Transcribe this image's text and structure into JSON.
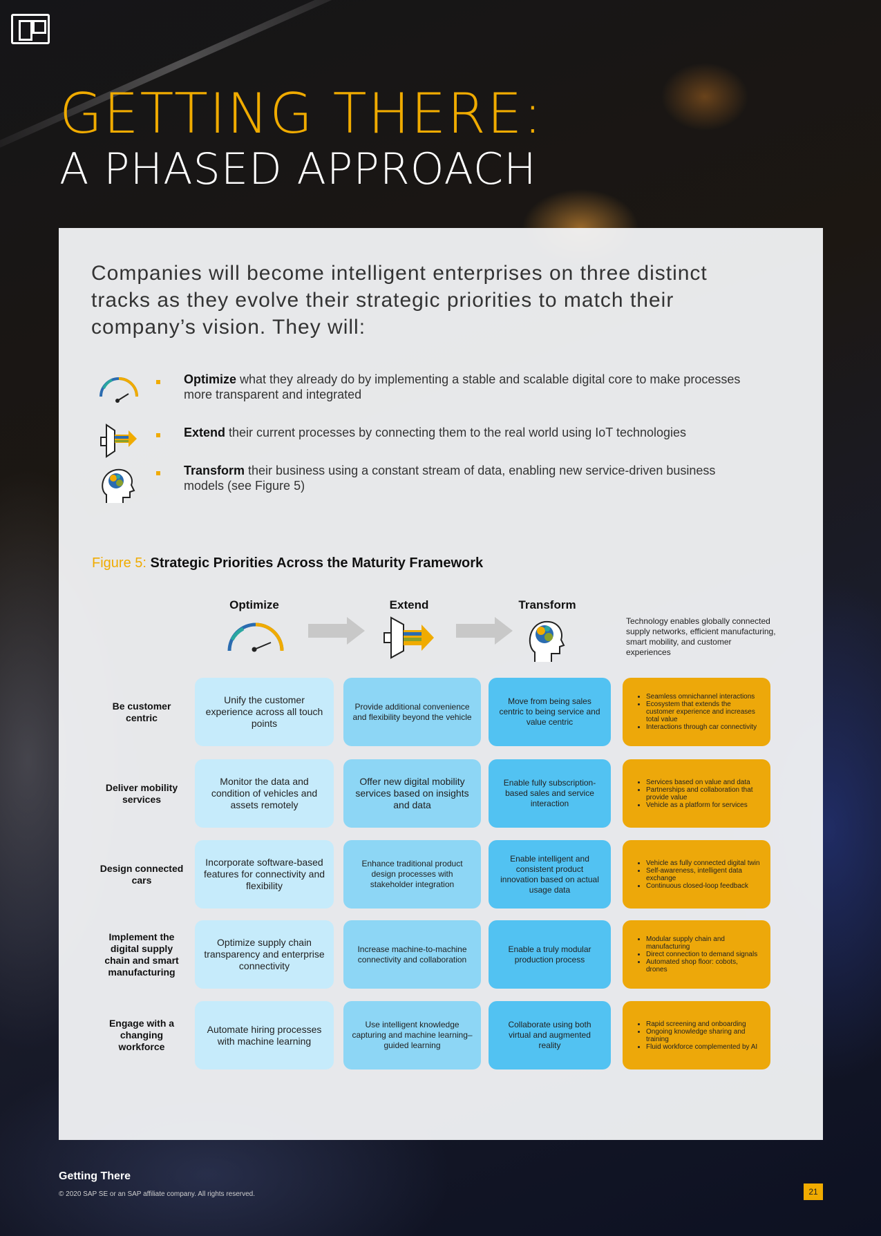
{
  "header": {
    "title_line1": "GETTING THERE:",
    "title_line2": "A PHASED APPROACH"
  },
  "intro": "Companies will become intelligent enterprises on three distinct tracks as they evolve their strategic priorities to match their company’s vision. They will:",
  "bullets": [
    {
      "icon": "gauge-icon",
      "bold": "Optimize",
      "text": " what they already do by implementing a stable and scalable digital core to make processes more transparent and integrated"
    },
    {
      "icon": "extend-arrow-icon",
      "bold": "Extend",
      "text": " their current processes by connecting them to the real world using IoT technologies"
    },
    {
      "icon": "brain-head-icon",
      "bold": "Transform",
      "text": " their business using a constant stream of data, enabling new service-driven business models (see Figure 5)"
    }
  ],
  "figure": {
    "label": "Figure 5:",
    "title": " Strategic Priorities Across the Maturity Framework",
    "columns": [
      "Optimize",
      "Extend",
      "Transform"
    ],
    "tech_note": "Technology enables globally connected supply networks, efficient manufacturing, smart mobility, and customer experiences",
    "rows": [
      {
        "label": "Be customer centric",
        "optimize": "Unify the customer experience across all touch points",
        "extend": "Provide additional convenience and flexibility beyond the vehicle",
        "transform": "Move from being sales centric to being service and value centric",
        "tech": [
          "Seamless omnichannel interactions",
          "Ecosystem that extends the customer experience and increases total value",
          "Interactions through car connectivity"
        ]
      },
      {
        "label": "Deliver mobility services",
        "optimize": "Monitor the data and condition of vehicles and assets remotely",
        "extend": "Offer new digital mobility services based on insights and data",
        "transform": "Enable fully subscription-based sales and service interaction",
        "tech": [
          "Services based on value and data",
          "Partnerships and collaboration that provide value",
          "Vehicle as a platform for services"
        ]
      },
      {
        "label": "Design connected cars",
        "optimize": "Incorporate software-based features for connectivity and flexibility",
        "extend": "Enhance traditional product design processes with stakeholder integration",
        "transform": "Enable intelligent and consistent product innovation based on actual usage data",
        "tech": [
          "Vehicle as fully connected digital twin",
          "Self-awareness, intelligent data exchange",
          "Continuous closed-loop feedback"
        ]
      },
      {
        "label": "Implement the digital supply chain and smart manufacturing",
        "optimize": "Optimize supply chain transparency and enterprise connectivity",
        "extend": "Increase machine-to-machine connectivity and collaboration",
        "transform": "Enable a truly modular production process",
        "tech": [
          "Modular supply chain and manufacturing",
          "Direct connection to demand signals",
          "Automated shop floor: cobots, drones"
        ]
      },
      {
        "label": "Engage with a changing workforce",
        "optimize": "Automate hiring processes with machine learning",
        "extend": "Use intelligent knowledge capturing and machine learning–guided learning",
        "transform": "Collaborate using both virtual and augmented reality",
        "tech": [
          "Rapid screening and onboarding",
          "Ongoing knowledge sharing and training",
          "Fluid workforce complemented by AI"
        ]
      }
    ]
  },
  "footer": {
    "title": "Getting There",
    "copyright": "© 2020 SAP SE or an SAP affiliate company. All rights reserved.",
    "page": "21"
  },
  "colors": {
    "accent": "#f0ab00",
    "light_blue": "#c6ebfb",
    "mid_blue": "#8dd6f5",
    "blue": "#52c2f2",
    "gold": "#eda80a"
  }
}
